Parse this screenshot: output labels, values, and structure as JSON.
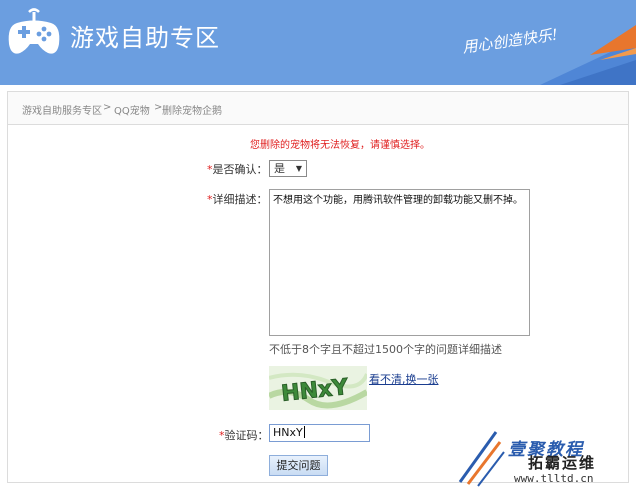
{
  "header": {
    "title": "游戏自助专区",
    "slogan": "用心创造快乐!",
    "logo_icon": "gamepad-icon",
    "colors": {
      "background": "#6b9ee0",
      "text": "#ffffff"
    }
  },
  "breadcrumb": {
    "items": [
      "游戏自助服务专区",
      "QQ宠物",
      "删除宠物企鹅"
    ],
    "separator": ">"
  },
  "form": {
    "warning": "您删除的宠物将无法恢复，请谨慎选择。",
    "required_mark": "*",
    "confirm": {
      "label": "是否确认：",
      "value": "是"
    },
    "description": {
      "label": "详细描述：",
      "value": "不想用这个功能，用腾讯软件管理的卸载功能又删不掉。",
      "hint": "不低于8个字且不超过1500个字的问题详细描述"
    },
    "captcha": {
      "image_text": "HNxY",
      "refresh_link": "看不清,换一张"
    },
    "verify_code": {
      "label": "验证码：",
      "value": "HNxY"
    },
    "submit_label": "提交问题"
  },
  "watermark": {
    "line1": "壹聚教程",
    "line2": "拓霸运维",
    "url": "www.tlltd.cn"
  }
}
